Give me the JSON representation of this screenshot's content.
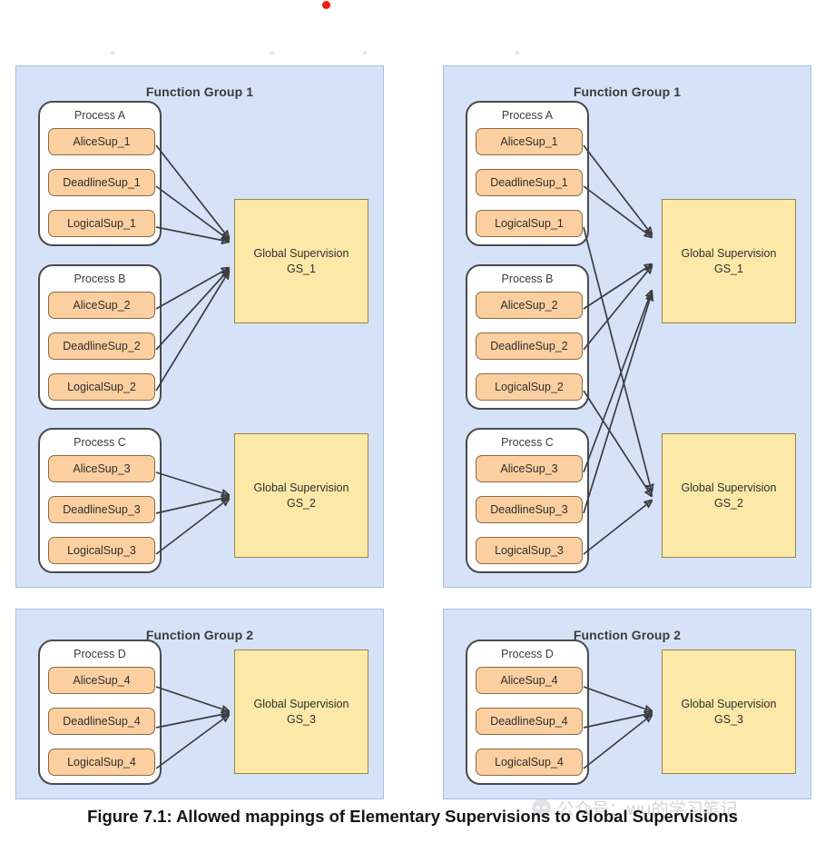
{
  "figure": {
    "caption": "Figure 7.1: Allowed mappings of Elementary Supervisions to Global Supervisions",
    "marker_color": "#f41b0d"
  },
  "watermark": {
    "icon": "wechat-icon",
    "text": "公众号：wu的学习笔记"
  },
  "colors": {
    "panel_fill": "#d5e2f7",
    "panel_border": "#a8bfe0",
    "process_fill": "#ffffff",
    "process_border": "#4a4a4a",
    "supervision_fill": "#fbcfa0",
    "supervision_border": "#8a6a42",
    "global_fill": "#fce9a8",
    "global_border": "#9a8348",
    "arrow": "#3d3d42"
  },
  "labels": {
    "function_group_1": "Function Group 1",
    "function_group_2": "Function Group 2",
    "process_a": "Process A",
    "process_b": "Process B",
    "process_c": "Process C",
    "process_d": "Process D",
    "gs_1": "Global Supervision\nGS_1",
    "gs_2": "Global Supervision\nGS_2",
    "gs_3": "Global Supervision\nGS_3",
    "alice_1": "AliceSup_1",
    "deadline_1": "DeadlineSup_1",
    "logical_1": "LogicalSup_1",
    "alice_2": "AliceSup_2",
    "deadline_2": "DeadlineSup_2",
    "logical_2": "LogicalSup_2",
    "alice_3": "AliceSup_3",
    "deadline_3": "DeadlineSup_3",
    "logical_3": "LogicalSup_3",
    "alice_4": "AliceSup_4",
    "deadline_4": "DeadlineSup_4",
    "logical_4": "LogicalSup_4"
  },
  "diagrams": [
    {
      "id": "left-top",
      "title": "Function Group 1",
      "variant": "allowed-grouped",
      "processes": [
        "Process A",
        "Process B",
        "Process C"
      ],
      "global_supervisions": [
        "GS_1",
        "GS_2"
      ],
      "mappings": [
        {
          "from": "AliceSup_1",
          "to": "GS_1"
        },
        {
          "from": "DeadlineSup_1",
          "to": "GS_1"
        },
        {
          "from": "LogicalSup_1",
          "to": "GS_1"
        },
        {
          "from": "AliceSup_2",
          "to": "GS_1"
        },
        {
          "from": "DeadlineSup_2",
          "to": "GS_1"
        },
        {
          "from": "LogicalSup_2",
          "to": "GS_1"
        },
        {
          "from": "AliceSup_3",
          "to": "GS_2"
        },
        {
          "from": "DeadlineSup_3",
          "to": "GS_2"
        },
        {
          "from": "LogicalSup_3",
          "to": "GS_2"
        }
      ]
    },
    {
      "id": "right-top",
      "title": "Function Group 1",
      "variant": "allowed-crossed",
      "processes": [
        "Process A",
        "Process B",
        "Process C"
      ],
      "global_supervisions": [
        "GS_1",
        "GS_2"
      ],
      "mappings": [
        {
          "from": "AliceSup_1",
          "to": "GS_1"
        },
        {
          "from": "DeadlineSup_1",
          "to": "GS_1"
        },
        {
          "from": "LogicalSup_1",
          "to": "GS_2"
        },
        {
          "from": "AliceSup_2",
          "to": "GS_1"
        },
        {
          "from": "DeadlineSup_2",
          "to": "GS_1"
        },
        {
          "from": "LogicalSup_2",
          "to": "GS_2"
        },
        {
          "from": "AliceSup_3",
          "to": "GS_1"
        },
        {
          "from": "DeadlineSup_3",
          "to": "GS_1"
        },
        {
          "from": "LogicalSup_3",
          "to": "GS_2"
        }
      ]
    },
    {
      "id": "left-bottom",
      "title": "Function Group 2",
      "variant": "allowed-grouped",
      "processes": [
        "Process D"
      ],
      "global_supervisions": [
        "GS_3"
      ],
      "mappings": [
        {
          "from": "AliceSup_4",
          "to": "GS_3"
        },
        {
          "from": "DeadlineSup_4",
          "to": "GS_3"
        },
        {
          "from": "LogicalSup_4",
          "to": "GS_3"
        }
      ]
    },
    {
      "id": "right-bottom",
      "title": "Function Group 2",
      "variant": "allowed-grouped",
      "processes": [
        "Process D"
      ],
      "global_supervisions": [
        "GS_3"
      ],
      "mappings": [
        {
          "from": "AliceSup_4",
          "to": "GS_3"
        },
        {
          "from": "DeadlineSup_4",
          "to": "GS_3"
        },
        {
          "from": "LogicalSup_4",
          "to": "GS_3"
        }
      ]
    }
  ]
}
